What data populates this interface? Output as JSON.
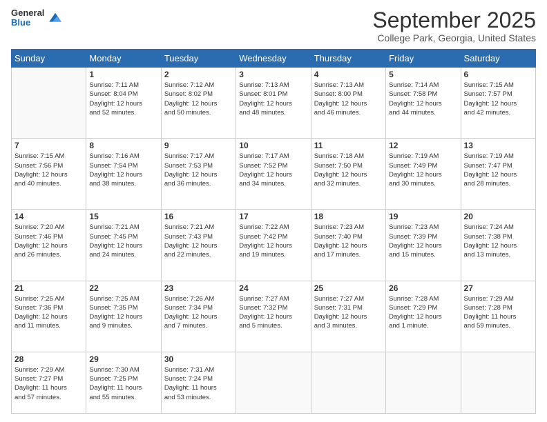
{
  "header": {
    "logo": {
      "general": "General",
      "blue": "Blue"
    },
    "title": "September 2025",
    "location": "College Park, Georgia, United States"
  },
  "days_header": [
    "Sunday",
    "Monday",
    "Tuesday",
    "Wednesday",
    "Thursday",
    "Friday",
    "Saturday"
  ],
  "weeks": [
    [
      {
        "num": "",
        "info": ""
      },
      {
        "num": "1",
        "info": "Sunrise: 7:11 AM\nSunset: 8:04 PM\nDaylight: 12 hours\nand 52 minutes."
      },
      {
        "num": "2",
        "info": "Sunrise: 7:12 AM\nSunset: 8:02 PM\nDaylight: 12 hours\nand 50 minutes."
      },
      {
        "num": "3",
        "info": "Sunrise: 7:13 AM\nSunset: 8:01 PM\nDaylight: 12 hours\nand 48 minutes."
      },
      {
        "num": "4",
        "info": "Sunrise: 7:13 AM\nSunset: 8:00 PM\nDaylight: 12 hours\nand 46 minutes."
      },
      {
        "num": "5",
        "info": "Sunrise: 7:14 AM\nSunset: 7:58 PM\nDaylight: 12 hours\nand 44 minutes."
      },
      {
        "num": "6",
        "info": "Sunrise: 7:15 AM\nSunset: 7:57 PM\nDaylight: 12 hours\nand 42 minutes."
      }
    ],
    [
      {
        "num": "7",
        "info": "Sunrise: 7:15 AM\nSunset: 7:56 PM\nDaylight: 12 hours\nand 40 minutes."
      },
      {
        "num": "8",
        "info": "Sunrise: 7:16 AM\nSunset: 7:54 PM\nDaylight: 12 hours\nand 38 minutes."
      },
      {
        "num": "9",
        "info": "Sunrise: 7:17 AM\nSunset: 7:53 PM\nDaylight: 12 hours\nand 36 minutes."
      },
      {
        "num": "10",
        "info": "Sunrise: 7:17 AM\nSunset: 7:52 PM\nDaylight: 12 hours\nand 34 minutes."
      },
      {
        "num": "11",
        "info": "Sunrise: 7:18 AM\nSunset: 7:50 PM\nDaylight: 12 hours\nand 32 minutes."
      },
      {
        "num": "12",
        "info": "Sunrise: 7:19 AM\nSunset: 7:49 PM\nDaylight: 12 hours\nand 30 minutes."
      },
      {
        "num": "13",
        "info": "Sunrise: 7:19 AM\nSunset: 7:47 PM\nDaylight: 12 hours\nand 28 minutes."
      }
    ],
    [
      {
        "num": "14",
        "info": "Sunrise: 7:20 AM\nSunset: 7:46 PM\nDaylight: 12 hours\nand 26 minutes."
      },
      {
        "num": "15",
        "info": "Sunrise: 7:21 AM\nSunset: 7:45 PM\nDaylight: 12 hours\nand 24 minutes."
      },
      {
        "num": "16",
        "info": "Sunrise: 7:21 AM\nSunset: 7:43 PM\nDaylight: 12 hours\nand 22 minutes."
      },
      {
        "num": "17",
        "info": "Sunrise: 7:22 AM\nSunset: 7:42 PM\nDaylight: 12 hours\nand 19 minutes."
      },
      {
        "num": "18",
        "info": "Sunrise: 7:23 AM\nSunset: 7:40 PM\nDaylight: 12 hours\nand 17 minutes."
      },
      {
        "num": "19",
        "info": "Sunrise: 7:23 AM\nSunset: 7:39 PM\nDaylight: 12 hours\nand 15 minutes."
      },
      {
        "num": "20",
        "info": "Sunrise: 7:24 AM\nSunset: 7:38 PM\nDaylight: 12 hours\nand 13 minutes."
      }
    ],
    [
      {
        "num": "21",
        "info": "Sunrise: 7:25 AM\nSunset: 7:36 PM\nDaylight: 12 hours\nand 11 minutes."
      },
      {
        "num": "22",
        "info": "Sunrise: 7:25 AM\nSunset: 7:35 PM\nDaylight: 12 hours\nand 9 minutes."
      },
      {
        "num": "23",
        "info": "Sunrise: 7:26 AM\nSunset: 7:34 PM\nDaylight: 12 hours\nand 7 minutes."
      },
      {
        "num": "24",
        "info": "Sunrise: 7:27 AM\nSunset: 7:32 PM\nDaylight: 12 hours\nand 5 minutes."
      },
      {
        "num": "25",
        "info": "Sunrise: 7:27 AM\nSunset: 7:31 PM\nDaylight: 12 hours\nand 3 minutes."
      },
      {
        "num": "26",
        "info": "Sunrise: 7:28 AM\nSunset: 7:29 PM\nDaylight: 12 hours\nand 1 minute."
      },
      {
        "num": "27",
        "info": "Sunrise: 7:29 AM\nSunset: 7:28 PM\nDaylight: 11 hours\nand 59 minutes."
      }
    ],
    [
      {
        "num": "28",
        "info": "Sunrise: 7:29 AM\nSunset: 7:27 PM\nDaylight: 11 hours\nand 57 minutes."
      },
      {
        "num": "29",
        "info": "Sunrise: 7:30 AM\nSunset: 7:25 PM\nDaylight: 11 hours\nand 55 minutes."
      },
      {
        "num": "30",
        "info": "Sunrise: 7:31 AM\nSunset: 7:24 PM\nDaylight: 11 hours\nand 53 minutes."
      },
      {
        "num": "",
        "info": ""
      },
      {
        "num": "",
        "info": ""
      },
      {
        "num": "",
        "info": ""
      },
      {
        "num": "",
        "info": ""
      }
    ]
  ]
}
